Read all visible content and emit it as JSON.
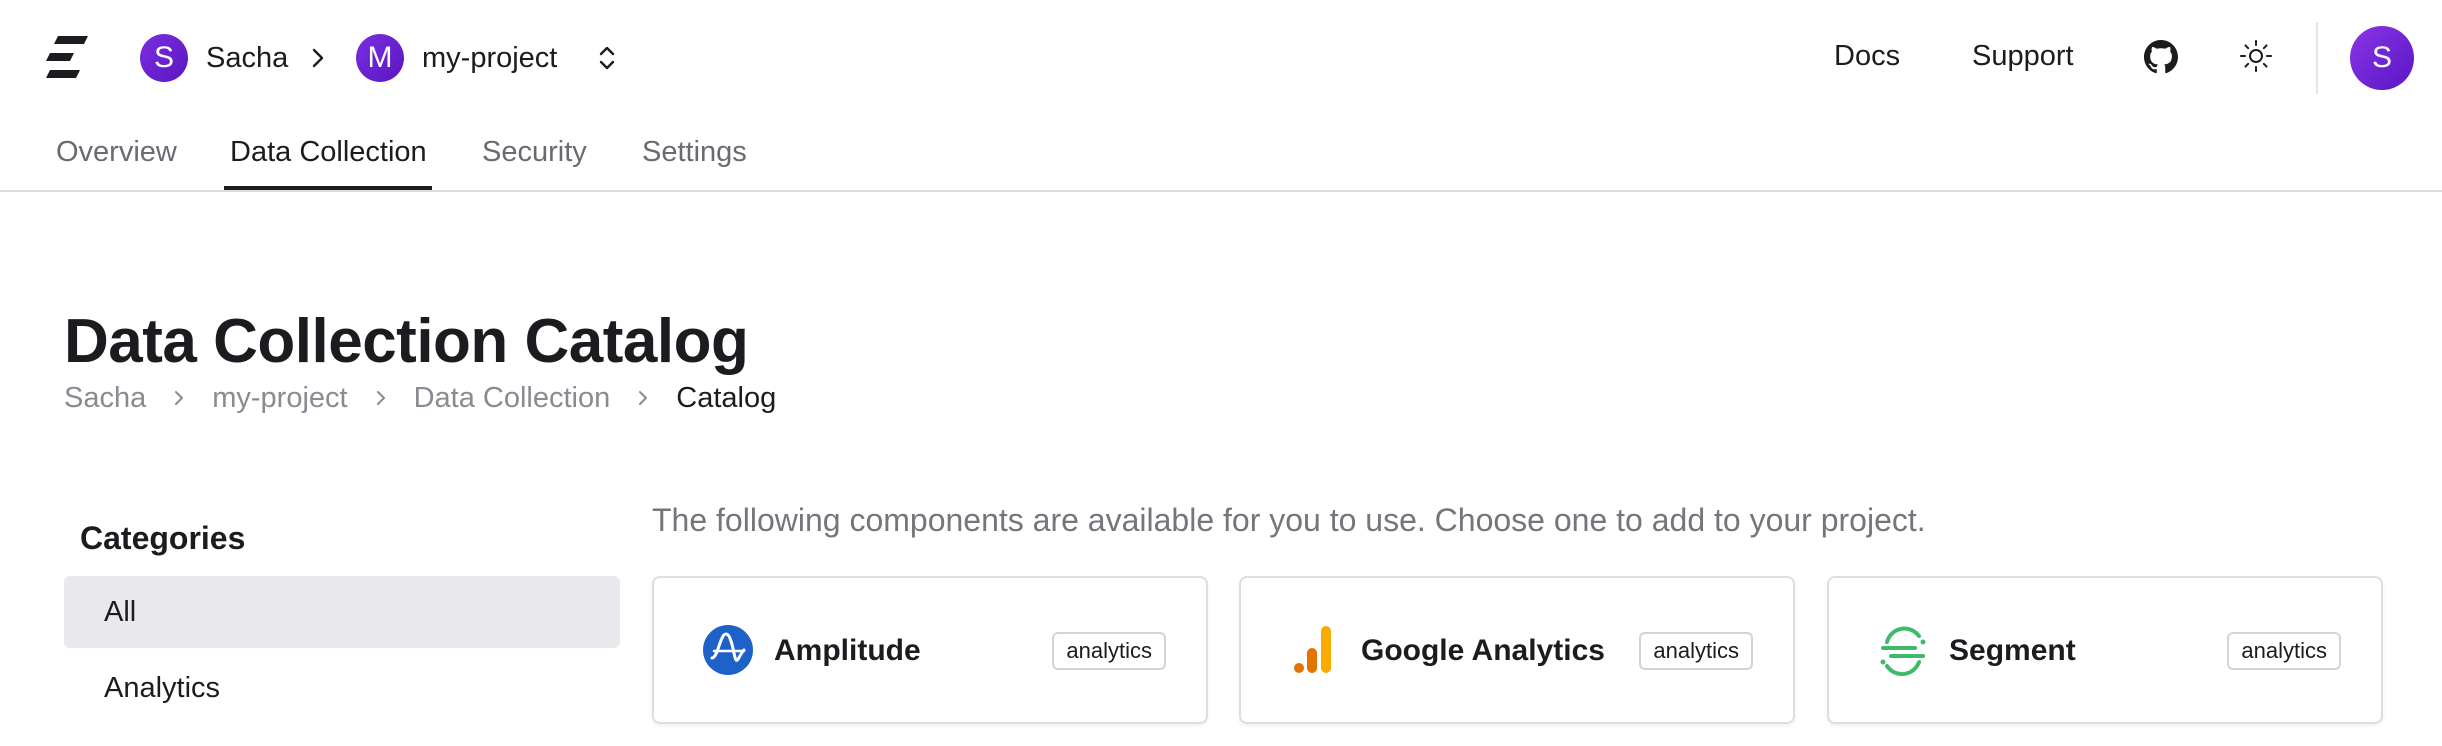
{
  "header": {
    "org_initial": "S",
    "org_name": "Sacha",
    "project_initial": "M",
    "project_name": "my-project",
    "docs_label": "Docs",
    "support_label": "Support",
    "github_icon": "github-icon",
    "theme_icon": "sun-icon",
    "user_initial": "S"
  },
  "tabs": [
    {
      "label": "Overview",
      "active": false
    },
    {
      "label": "Data Collection",
      "active": true
    },
    {
      "label": "Security",
      "active": false
    },
    {
      "label": "Settings",
      "active": false
    }
  ],
  "page": {
    "title": "Data Collection Catalog",
    "breadcrumb": [
      "Sacha",
      "my-project",
      "Data Collection",
      "Catalog"
    ]
  },
  "sidebar": {
    "title": "Categories",
    "items": [
      {
        "label": "All",
        "selected": true
      },
      {
        "label": "Analytics",
        "selected": false
      }
    ]
  },
  "catalog": {
    "intro": "The following components are available for you to use. Choose one to add to your project.",
    "cards": [
      {
        "name": "Amplitude",
        "badge": "analytics",
        "icon": "amplitude-icon"
      },
      {
        "name": "Google Analytics",
        "badge": "analytics",
        "icon": "google-analytics-icon"
      },
      {
        "name": "Segment",
        "badge": "analytics",
        "icon": "segment-icon"
      }
    ]
  },
  "colors": {
    "avatar": "#6a22d4",
    "amplitude": "#1e61c8",
    "google_analytics": "#f29900",
    "segment": "#3fba6a"
  }
}
